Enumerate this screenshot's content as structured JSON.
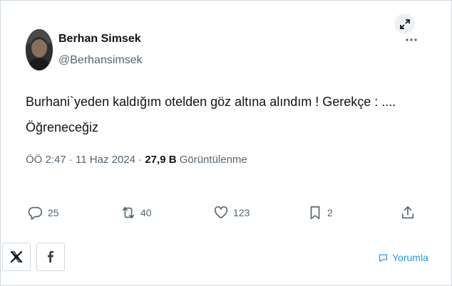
{
  "tweet": {
    "author_name": "Berhan Simsek",
    "author_handle": "@Berhansimsek",
    "text_line1": "Burhani`yeden kaldığım otelden göz altına alındım ! Gerekçe : ....",
    "text_line2": "Öğreneceğiz",
    "time": "ÖÖ 2:47",
    "separator1": " · ",
    "date": "11 Haz 2024",
    "separator2": " · ",
    "views_count": "27,9 B",
    "views_label": " Görüntülenme"
  },
  "actions": {
    "replies": "25",
    "retweets": "40",
    "likes": "123",
    "bookmarks": "2"
  },
  "share": {
    "reply_label": "Yorumla"
  },
  "icons": {
    "expand": "expand-arrows-icon",
    "more": "more-dots-icon",
    "reply": "speech-bubble-icon",
    "retweet": "retweet-icon",
    "like": "heart-icon",
    "bookmark": "bookmark-icon",
    "share": "share-upload-icon",
    "x": "x-logo-icon",
    "facebook": "facebook-logo-icon",
    "comment": "comment-bubble-icon"
  },
  "colors": {
    "text": "#0f1419",
    "secondary": "#536471",
    "accent": "#1d9bf0",
    "border": "#cfd9de"
  }
}
